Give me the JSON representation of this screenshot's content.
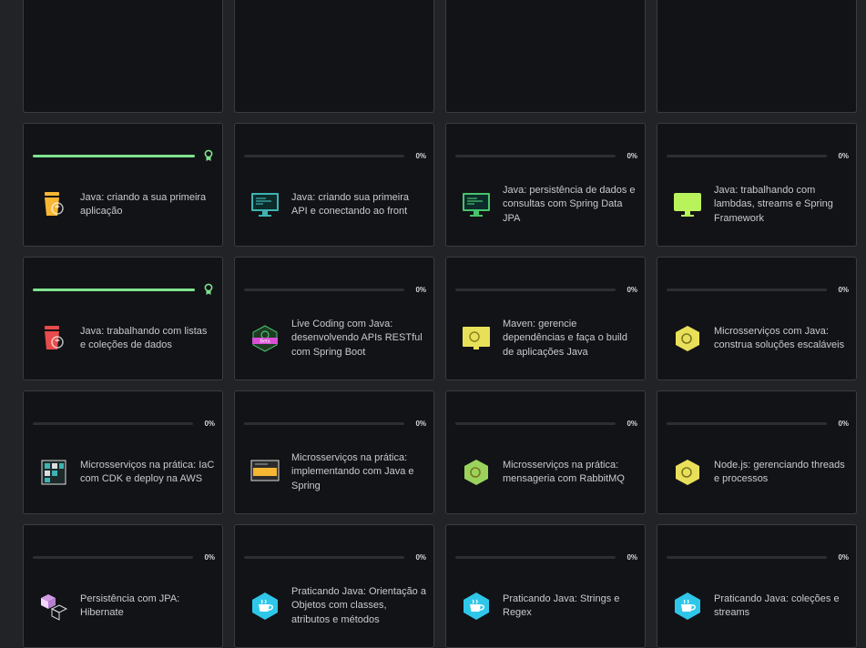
{
  "cards": [
    {
      "id": "p1",
      "partial": true
    },
    {
      "id": "p2",
      "partial": true
    },
    {
      "id": "p3",
      "partial": true
    },
    {
      "id": "p4",
      "partial": true
    },
    {
      "id": "c1",
      "title": "Java: criando a sua primeira aplicação",
      "progress": 100,
      "completed": true,
      "icon": "java-cup-icon",
      "color": "#f7b733"
    },
    {
      "id": "c2",
      "title": "Java: criando sua primeira API e conectando ao front",
      "progress": 0,
      "progress_label": "0%",
      "icon": "monitor-code-icon",
      "color": "#3fb3b3"
    },
    {
      "id": "c3",
      "title": "Java: persistência de dados e consultas com Spring Data JPA",
      "progress": 0,
      "progress_label": "0%",
      "icon": "monitor-code-icon",
      "color": "#46c46b"
    },
    {
      "id": "c4",
      "title": "Java: trabalhando com lambdas, streams e Spring Framework",
      "progress": 0,
      "progress_label": "0%",
      "icon": "monitor-icon",
      "color": "#b8f35c"
    },
    {
      "id": "c5",
      "title": "Java: trabalhando com listas e coleções de dados",
      "progress": 100,
      "completed": true,
      "icon": "java-cup-icon",
      "color": "#e84b4b"
    },
    {
      "id": "c6",
      "title": "Live Coding com Java: desenvolvendo APIs RESTful com Spring Boot",
      "progress": 0,
      "progress_label": "0%",
      "icon": "beta-hex-icon",
      "color": "#47c46a",
      "badge_text": "Beta"
    },
    {
      "id": "c7",
      "title": "Maven: gerencie dependências e faça o build de aplicações Java",
      "progress": 0,
      "progress_label": "0%",
      "icon": "monitor-gear-icon",
      "color": "#e9e05a"
    },
    {
      "id": "c8",
      "title": "Microsserviços com Java: construa soluções escaláveis",
      "progress": 0,
      "progress_label": "0%",
      "icon": "hex-gear-icon",
      "color": "#e9e05a"
    },
    {
      "id": "c9",
      "title": "Microsserviços na prática: IaC com CDK e deploy na AWS",
      "progress": 0,
      "progress_label": "0%",
      "icon": "grid-icon",
      "color": "#3fb3b3"
    },
    {
      "id": "c10",
      "title": "Microsserviços na prática: implementando com Java e Spring",
      "progress": 0,
      "progress_label": "0%",
      "icon": "monitor-stripe-icon",
      "color": "#f7b733"
    },
    {
      "id": "c11",
      "title": "Microsserviços na prática: mensageria com RabbitMQ",
      "progress": 0,
      "progress_label": "0%",
      "icon": "hex-gear-icon",
      "color": "#9ad35c"
    },
    {
      "id": "c12",
      "title": "Node.js: gerenciando threads e processos",
      "progress": 0,
      "progress_label": "0%",
      "icon": "hex-gear-icon",
      "color": "#e9e05a"
    },
    {
      "id": "c13",
      "title": "Persistência com JPA: Hibernate",
      "progress": 0,
      "progress_label": "0%",
      "icon": "cubes-icon",
      "color": "#d29be6"
    },
    {
      "id": "c14",
      "title": "Praticando Java: Orientação a Objetos com classes, atributos e métodos",
      "progress": 0,
      "progress_label": "0%",
      "icon": "hex-cup-icon",
      "color": "#2ec7ea"
    },
    {
      "id": "c15",
      "title": "Praticando Java: Strings e Regex",
      "progress": 0,
      "progress_label": "0%",
      "icon": "hex-cup-icon",
      "color": "#2ec7ea"
    },
    {
      "id": "c16",
      "title": "Praticando Java: coleções e streams",
      "progress": 0,
      "progress_label": "0%",
      "icon": "hex-cup-icon",
      "color": "#2ec7ea"
    }
  ]
}
